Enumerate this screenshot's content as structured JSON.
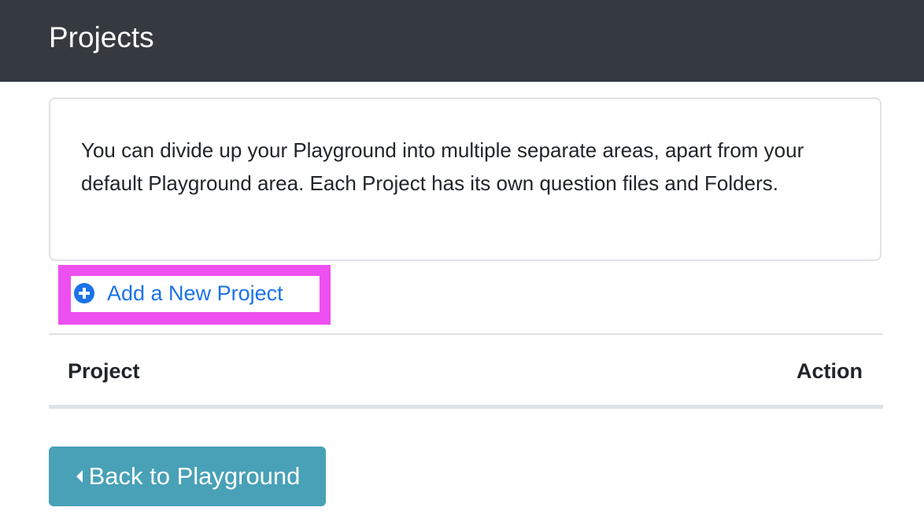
{
  "header": {
    "title": "Projects"
  },
  "info": {
    "text": "You can divide up your Playground into multiple separate areas, apart from your default Playground area. Each Project has its own question files and Folders."
  },
  "actions": {
    "add_project_label": "Add a New Project",
    "add_project_icon": "plus-circle-icon"
  },
  "table": {
    "columns": [
      "Project",
      "Action"
    ],
    "rows": []
  },
  "footer": {
    "back_label": "Back to Playground",
    "back_icon": "caret-left-icon"
  },
  "colors": {
    "header_bg": "#343a40",
    "link": "#1a73e8",
    "highlight": "#ee4ff0",
    "button_bg": "#48a1b7"
  }
}
